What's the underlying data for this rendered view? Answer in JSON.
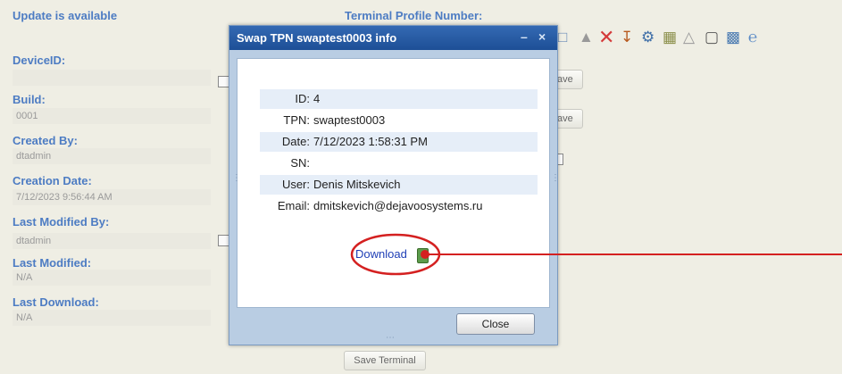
{
  "page": {
    "update_available": "Update is available",
    "terminal_profile_number": "Terminal Profile Number:",
    "fields": [
      {
        "label": "DeviceID:",
        "value": ""
      },
      {
        "label": "Build:",
        "value": "0001"
      },
      {
        "label": "Created By:",
        "value": "dtadmin"
      },
      {
        "label": "Creation Date:",
        "value": "7/12/2023 9:56:44 AM"
      },
      {
        "label": "Last Modified By:",
        "value": "dtadmin"
      },
      {
        "label": "Last Modified:",
        "value": "N/A"
      },
      {
        "label": "Last Download:",
        "value": "N/A"
      }
    ],
    "save_partial_1": "ave",
    "save_partial_2": "ave",
    "save_terminal": "Save Terminal",
    "toolbar_icons": [
      "copy-icon",
      "trash-icon",
      "delete-x-icon",
      "download-icon",
      "settings-icon",
      "package-icon",
      "warning-icon",
      "square-icon",
      "export-icon",
      "ie-icon"
    ]
  },
  "dialog": {
    "title": "Swap TPN swaptest0003 info",
    "rows": [
      {
        "key": "ID:",
        "value": "4"
      },
      {
        "key": "TPN:",
        "value": "swaptest0003"
      },
      {
        "key": "Date:",
        "value": "7/12/2023 1:58:31 PM"
      },
      {
        "key": "SN:",
        "value": ""
      },
      {
        "key": "User:",
        "value": "Denis Mitskevich"
      },
      {
        "key": "Email:",
        "value": "dmitskevich@dejavoosystems.ru"
      }
    ],
    "download_label": "Download",
    "close_label": "Close",
    "minimize_glyph": "–",
    "close_glyph": "×"
  },
  "colors": {
    "label_blue": "#4d7cc3",
    "dialog_title": "#2a5ea8",
    "annotation_red": "#d42020"
  }
}
